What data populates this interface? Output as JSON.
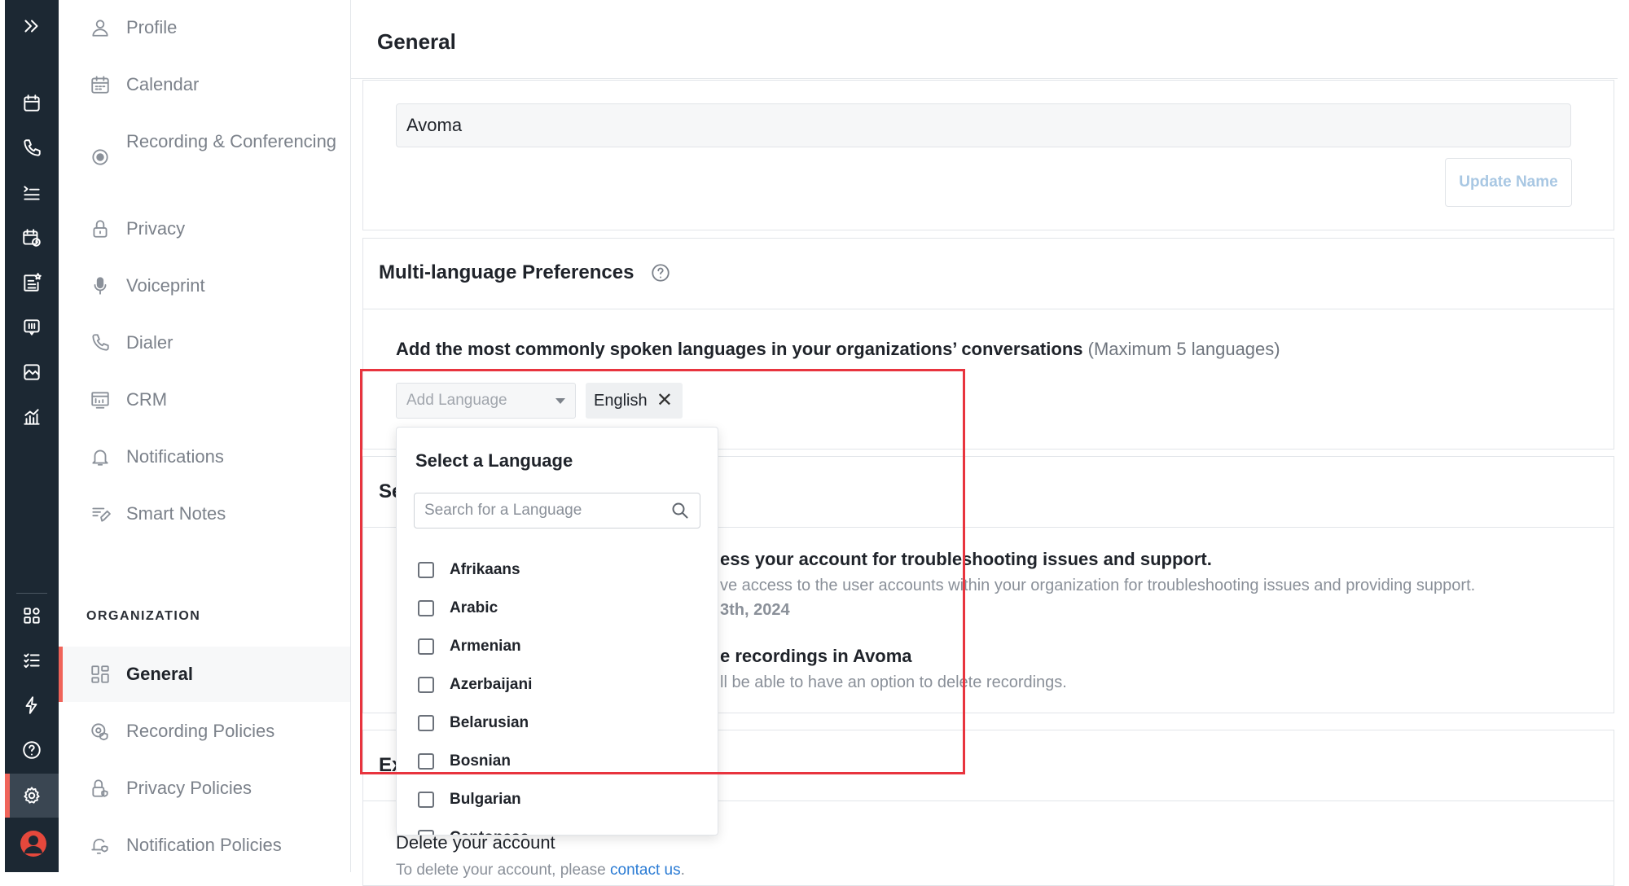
{
  "rail": {
    "icons": [
      "expand-icon",
      "calendar-icon",
      "phone-icon",
      "meetings-list-icon",
      "scheduler-icon",
      "notes-star-icon",
      "feedback-icon",
      "insights-icon",
      "analytics-icon",
      "apps-grid-icon",
      "tasks-icon",
      "lightning-icon",
      "help-icon",
      "settings-icon",
      "user-avatar-icon"
    ],
    "active": "settings-icon",
    "accent_color": "#f0645a"
  },
  "nav": {
    "items": [
      {
        "label": "Profile",
        "icon": "person-icon"
      },
      {
        "label": "Calendar",
        "icon": "calendar-icon"
      },
      {
        "label": "Recording & Conferencing",
        "icon": "record-icon"
      },
      {
        "label": "Privacy",
        "icon": "lock-icon"
      },
      {
        "label": "Voiceprint",
        "icon": "microphone-icon"
      },
      {
        "label": "Dialer",
        "icon": "phone-icon"
      },
      {
        "label": "CRM",
        "icon": "crm-icon"
      },
      {
        "label": "Notifications",
        "icon": "bell-icon"
      },
      {
        "label": "Smart Notes",
        "icon": "smart-notes-icon"
      }
    ],
    "org_section": "ORGANIZATION",
    "org_items": [
      {
        "label": "General",
        "icon": "dashboard-icon",
        "active": true
      },
      {
        "label": "Recording Policies",
        "icon": "recording-policy-icon"
      },
      {
        "label": "Privacy Policies",
        "icon": "privacy-policy-icon"
      },
      {
        "label": "Notification Policies",
        "icon": "notification-policy-icon"
      }
    ]
  },
  "main": {
    "title": "General",
    "org_name": {
      "value": "Avoma",
      "button": "Update Name"
    },
    "multilang": {
      "title": "Multi-language Preferences",
      "desc_bold": "Add the most commonly spoken languages in your organizations’ conversations",
      "desc_muted": " (Maximum 5 languages)",
      "add_placeholder": "Add Language",
      "selected": [
        "English"
      ]
    },
    "support": {
      "title_visible": "Se",
      "access_title_partial": "ess your account for troubleshooting issues and support.",
      "access_desc_partial": "ve access to the user accounts within your organization for troubleshooting issues and providing support.",
      "date_partial": "3th, 2024",
      "delete_title_partial": "e recordings in Avoma",
      "delete_desc_partial": "ll be able to have an option to delete recordings."
    },
    "export_title_visible": "Ex",
    "delete_account": {
      "title": "Delete your account",
      "sub": "To delete your account, please ",
      "link": "contact us",
      "tail": "."
    }
  },
  "dropdown": {
    "title": "Select a Language",
    "search_placeholder": "Search for a Language",
    "options": [
      "Afrikaans",
      "Arabic",
      "Armenian",
      "Azerbaijani",
      "Belarusian",
      "Bosnian",
      "Bulgarian",
      "Cantonese"
    ]
  },
  "highlight_color": "#e8343e"
}
